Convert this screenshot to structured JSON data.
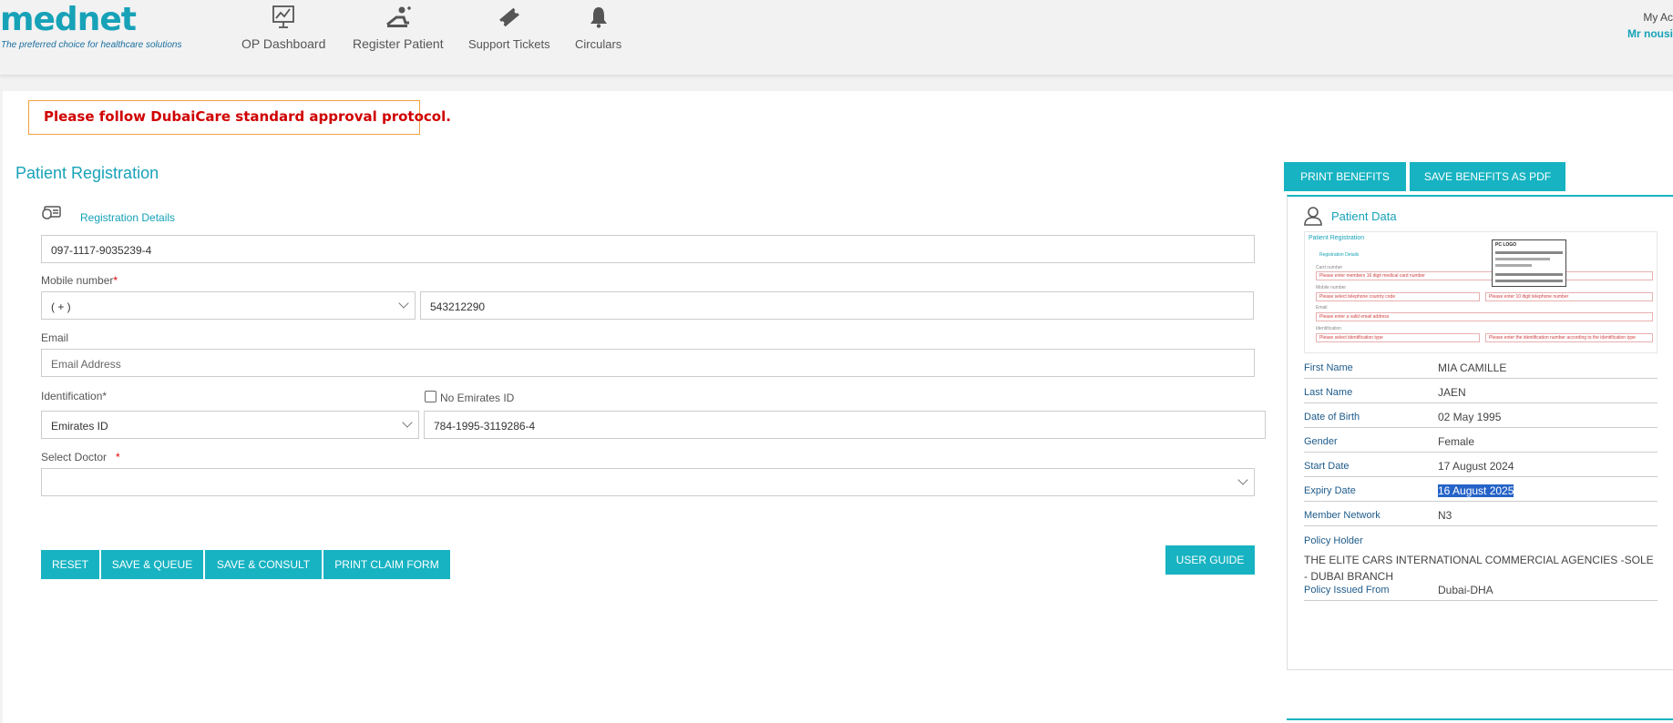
{
  "header": {
    "logo_text": "mednet",
    "logo_tagline": "The preferred choice for healthcare solutions",
    "nav": [
      {
        "label": "OP Dashboard",
        "icon": "chart-monitor-icon"
      },
      {
        "label": "Register Patient",
        "icon": "register-patient-icon"
      },
      {
        "label": "Support Tickets",
        "icon": "ticket-icon"
      },
      {
        "label": "Circulars",
        "icon": "bell-icon"
      }
    ],
    "account_label": "My Ac",
    "account_name": "Mr nousi"
  },
  "notice": "Please follow DubaiCare standard approval protocol.",
  "form": {
    "title": "Patient Registration",
    "section_label": "Registration Details",
    "card_number": "097-1117-9035239-4",
    "mobile_label": "Mobile number",
    "required_mark": "*",
    "country_code": "( + )",
    "mobile_number": "543212290",
    "email_label": "Email",
    "email_placeholder": "Email Address",
    "identification_label": "Identification*",
    "no_emirates_id_label": "No Emirates ID",
    "id_type": "Emirates ID",
    "id_number": "784-1995-3119286-4",
    "doctor_label": "Select Doctor",
    "doctor_value": ""
  },
  "buttons": {
    "reset": "RESET",
    "save_queue": "SAVE & QUEUE",
    "save_consult": "SAVE & CONSULT",
    "print_claim": "PRINT CLAIM FORM",
    "user_guide": "USER GUIDE",
    "print_benefits": "PRINT BENEFITS",
    "save_benefits_pdf": "SAVE BENEFITS AS PDF"
  },
  "patient_data": {
    "title": "Patient Data",
    "thumb": {
      "title": "Patient Registration",
      "section": "Registration Details",
      "card_label": "Card number",
      "card_hint": "Please enter members 16 digit medical card number",
      "mobile_label": "Mobile number",
      "mobile_hint_a": "Please select telephone country code",
      "mobile_hint_b": "Please enter 10 digit telephone number",
      "email_label": "Email",
      "email_hint": "Please enter a valid email address",
      "id_label": "Identification",
      "id_hint_a": "Please select identification type",
      "id_hint_b": "Please enter the identification number according to the identification type",
      "card_logo": "PC LOGO"
    },
    "rows": [
      {
        "key": "First Name",
        "value": "MIA CAMILLE"
      },
      {
        "key": "Last Name",
        "value": "JAEN"
      },
      {
        "key": "Date of Birth",
        "value": "02 May 1995"
      },
      {
        "key": "Gender",
        "value": "Female"
      },
      {
        "key": "Start Date",
        "value": "17 August 2024"
      },
      {
        "key": "Expiry Date",
        "value": "16 August 2025"
      },
      {
        "key": "Member Network",
        "value": "N3"
      }
    ],
    "policy_holder_label": "Policy Holder",
    "policy_holder_value": "THE ELITE CARS INTERNATIONAL COMMERCIAL AGENCIES -SOLE - DUBAI BRANCH",
    "policy_issued_label": "Policy Issued From",
    "policy_issued_value": "Dubai-DHA"
  },
  "colors": {
    "accent": "#17b3c2",
    "notice_text": "#d00000",
    "notice_border": "#f0a040",
    "key_text": "#1e5b8a",
    "selection": "#2563c8"
  }
}
